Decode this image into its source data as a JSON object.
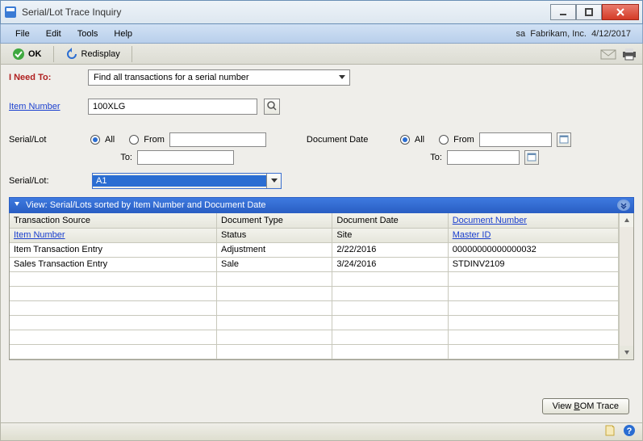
{
  "window": {
    "title": "Serial/Lot Trace Inquiry"
  },
  "menubar": {
    "items": [
      "File",
      "Edit",
      "Tools",
      "Help"
    ],
    "user": "sa",
    "company": "Fabrikam, Inc.",
    "date": "4/12/2017"
  },
  "toolbar": {
    "ok_label": "OK",
    "redisplay_label": "Redisplay"
  },
  "labels": {
    "i_need_to": "I Need To:",
    "item_number": "Item Number",
    "serial_lot": "Serial/Lot",
    "document_date": "Document Date",
    "all": "All",
    "from": "From",
    "to": "To:",
    "serial_lot_colon": "Serial/Lot:"
  },
  "i_need_to_value": "Find all transactions for a serial number",
  "item_number_value": "100XLG",
  "serial_lot_filter": {
    "mode": "All",
    "from": "",
    "to": ""
  },
  "doc_date_filter": {
    "mode": "All",
    "from": "",
    "to": ""
  },
  "serial_lot_selected": "A1",
  "view_bar_text": "View: Serial/Lots sorted by Item Number and  Document Date",
  "grid": {
    "header1": [
      "Transaction Source",
      "Document Type",
      "Document Date",
      "Document Number"
    ],
    "header2": [
      "Item Number",
      "Status",
      "Site",
      "Master ID"
    ],
    "rows": [
      {
        "c0": "Item Transaction Entry",
        "c1": "Adjustment",
        "c2": "2/22/2016",
        "c3": "00000000000000032"
      },
      {
        "c0": "Sales Transaction Entry",
        "c1": "Sale",
        "c2": "3/24/2016",
        "c3": "STDINV2109"
      }
    ]
  },
  "buttons": {
    "view_bom_trace": "View BOM Trace"
  },
  "icons": {
    "app": "app-icon",
    "minimize": "minimize-icon",
    "maximize": "maximize-icon",
    "close": "close-icon",
    "ok": "ok-check-icon",
    "redisplay": "redisplay-icon",
    "email": "email-icon",
    "print": "printer-icon",
    "lookup": "magnifier-icon",
    "calendar": "calendar-icon",
    "caret": "caret-down-icon",
    "expand": "expand-chevron-icon",
    "note": "note-icon",
    "help": "help-icon"
  }
}
